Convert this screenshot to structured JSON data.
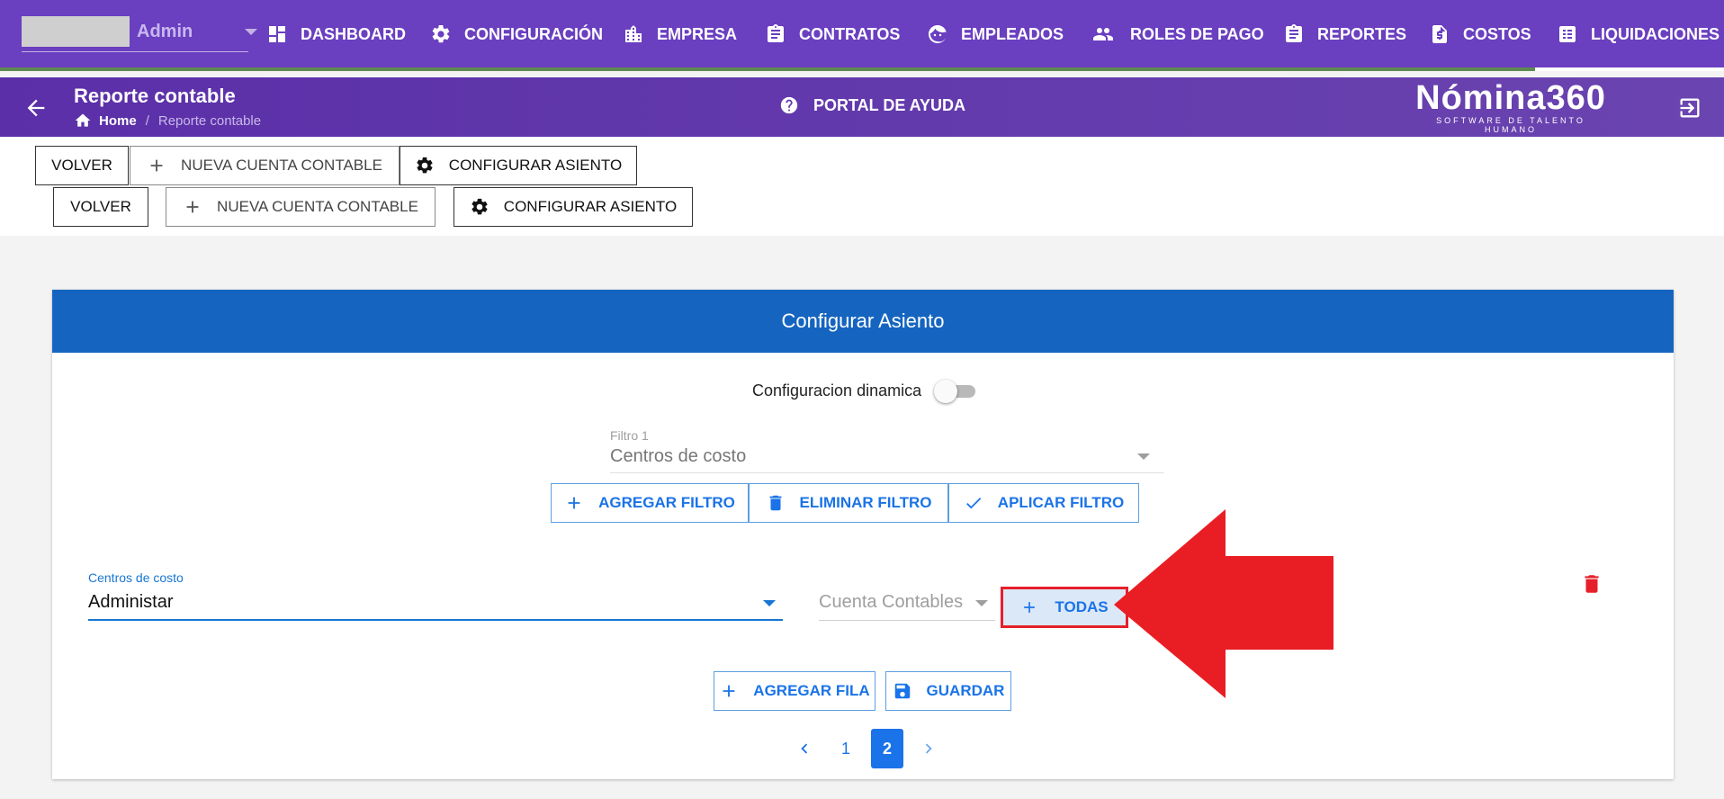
{
  "topnav": {
    "username": "Admin",
    "items": [
      {
        "label": "DASHBOARD",
        "icon": "dashboard-icon"
      },
      {
        "label": "CONFIGURACIÓN",
        "icon": "gear-icon"
      },
      {
        "label": "EMPRESA",
        "icon": "building-icon"
      },
      {
        "label": "CONTRATOS",
        "icon": "clipboard-icon"
      },
      {
        "label": "EMPLEADOS",
        "icon": "face-icon"
      },
      {
        "label": "ROLES DE PAGO",
        "icon": "people-icon"
      },
      {
        "label": "REPORTES",
        "icon": "clipboard-icon"
      },
      {
        "label": "COSTOS",
        "icon": "invoice-dollar-icon"
      },
      {
        "label": "LIQUIDACIONES",
        "icon": "list-icon"
      }
    ]
  },
  "subbar": {
    "title": "Reporte contable",
    "breadcrumb": {
      "home": "Home",
      "separator": "/",
      "current": "Reporte contable"
    },
    "help_label": "PORTAL DE AYUDA",
    "logo_main": "Nómina360",
    "logo_tagline": "SOFTWARE DE TALENTO HUMANO"
  },
  "toolbar": {
    "volver": "VOLVER",
    "nueva_cuenta": "NUEVA CUENTA CONTABLE",
    "configurar_asiento": "CONFIGURAR ASIENTO"
  },
  "card": {
    "title": "Configurar Asiento",
    "switch_label": "Configuracion dinamica",
    "filter": {
      "label": "Filtro 1",
      "value": "Centros de costo"
    },
    "filter_buttons": {
      "agregar": "AGREGAR FILTRO",
      "eliminar": "ELIMINAR FILTRO",
      "aplicar": "APLICAR FILTRO"
    },
    "row": {
      "centro_label": "Centros de costo",
      "centro_value": "Administar",
      "cuenta_placeholder": "Cuenta Contables",
      "todas_label": "TODAS"
    },
    "bottom_buttons": {
      "agregar_fila": "AGREGAR FILA",
      "guardar": "GUARDAR"
    },
    "pagination": {
      "pages": [
        "1",
        "2"
      ],
      "active": "2"
    }
  },
  "colors": {
    "nav_purple": "#6a3fc0",
    "header_blue": "#1565c0",
    "accent_blue": "#1a73e8",
    "highlight_red": "#e5202a"
  }
}
